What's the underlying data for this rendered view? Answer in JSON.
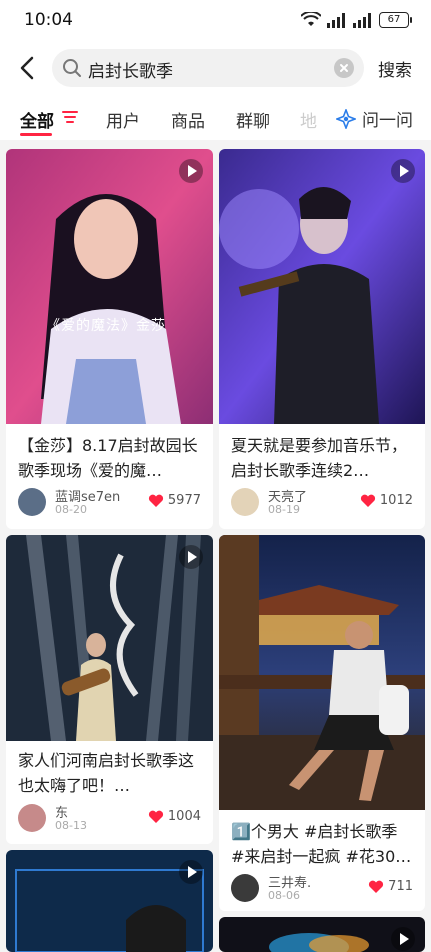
{
  "status": {
    "time": "10:04",
    "battery": "67"
  },
  "search": {
    "query": "启封长歌季",
    "button": "搜索"
  },
  "tabs": {
    "all": "全部",
    "users": "用户",
    "goods": "商品",
    "groups": "群聊",
    "faded": "地",
    "ask": "问一问"
  },
  "colors": {
    "accent": "#ff2442",
    "like": "#ff2442"
  },
  "posts": [
    {
      "title": "【金莎】8.17启封故园长歌季现场《爱的魔…",
      "caption": "《爱的魔法》金莎",
      "author": "蓝调se7en",
      "date": "08-20",
      "likes": "5977",
      "video": true
    },
    {
      "title": "夏天就是要参加音乐节，启封长歌季连续2…",
      "author": "天亮了",
      "date": "08-19",
      "likes": "1012",
      "video": true
    },
    {
      "title": "家人们河南启封长歌季这也太嗨了吧！…",
      "author": "东",
      "date": "08-13",
      "likes": "1004",
      "video": true
    },
    {
      "title": "1️⃣个男大 #启封长歌季 #来启封一起疯 #花30…",
      "author": "三井寿.",
      "date": "08-06",
      "likes": "711",
      "video": false
    },
    {
      "title": "",
      "video": true
    },
    {
      "title": "",
      "video": true
    }
  ]
}
